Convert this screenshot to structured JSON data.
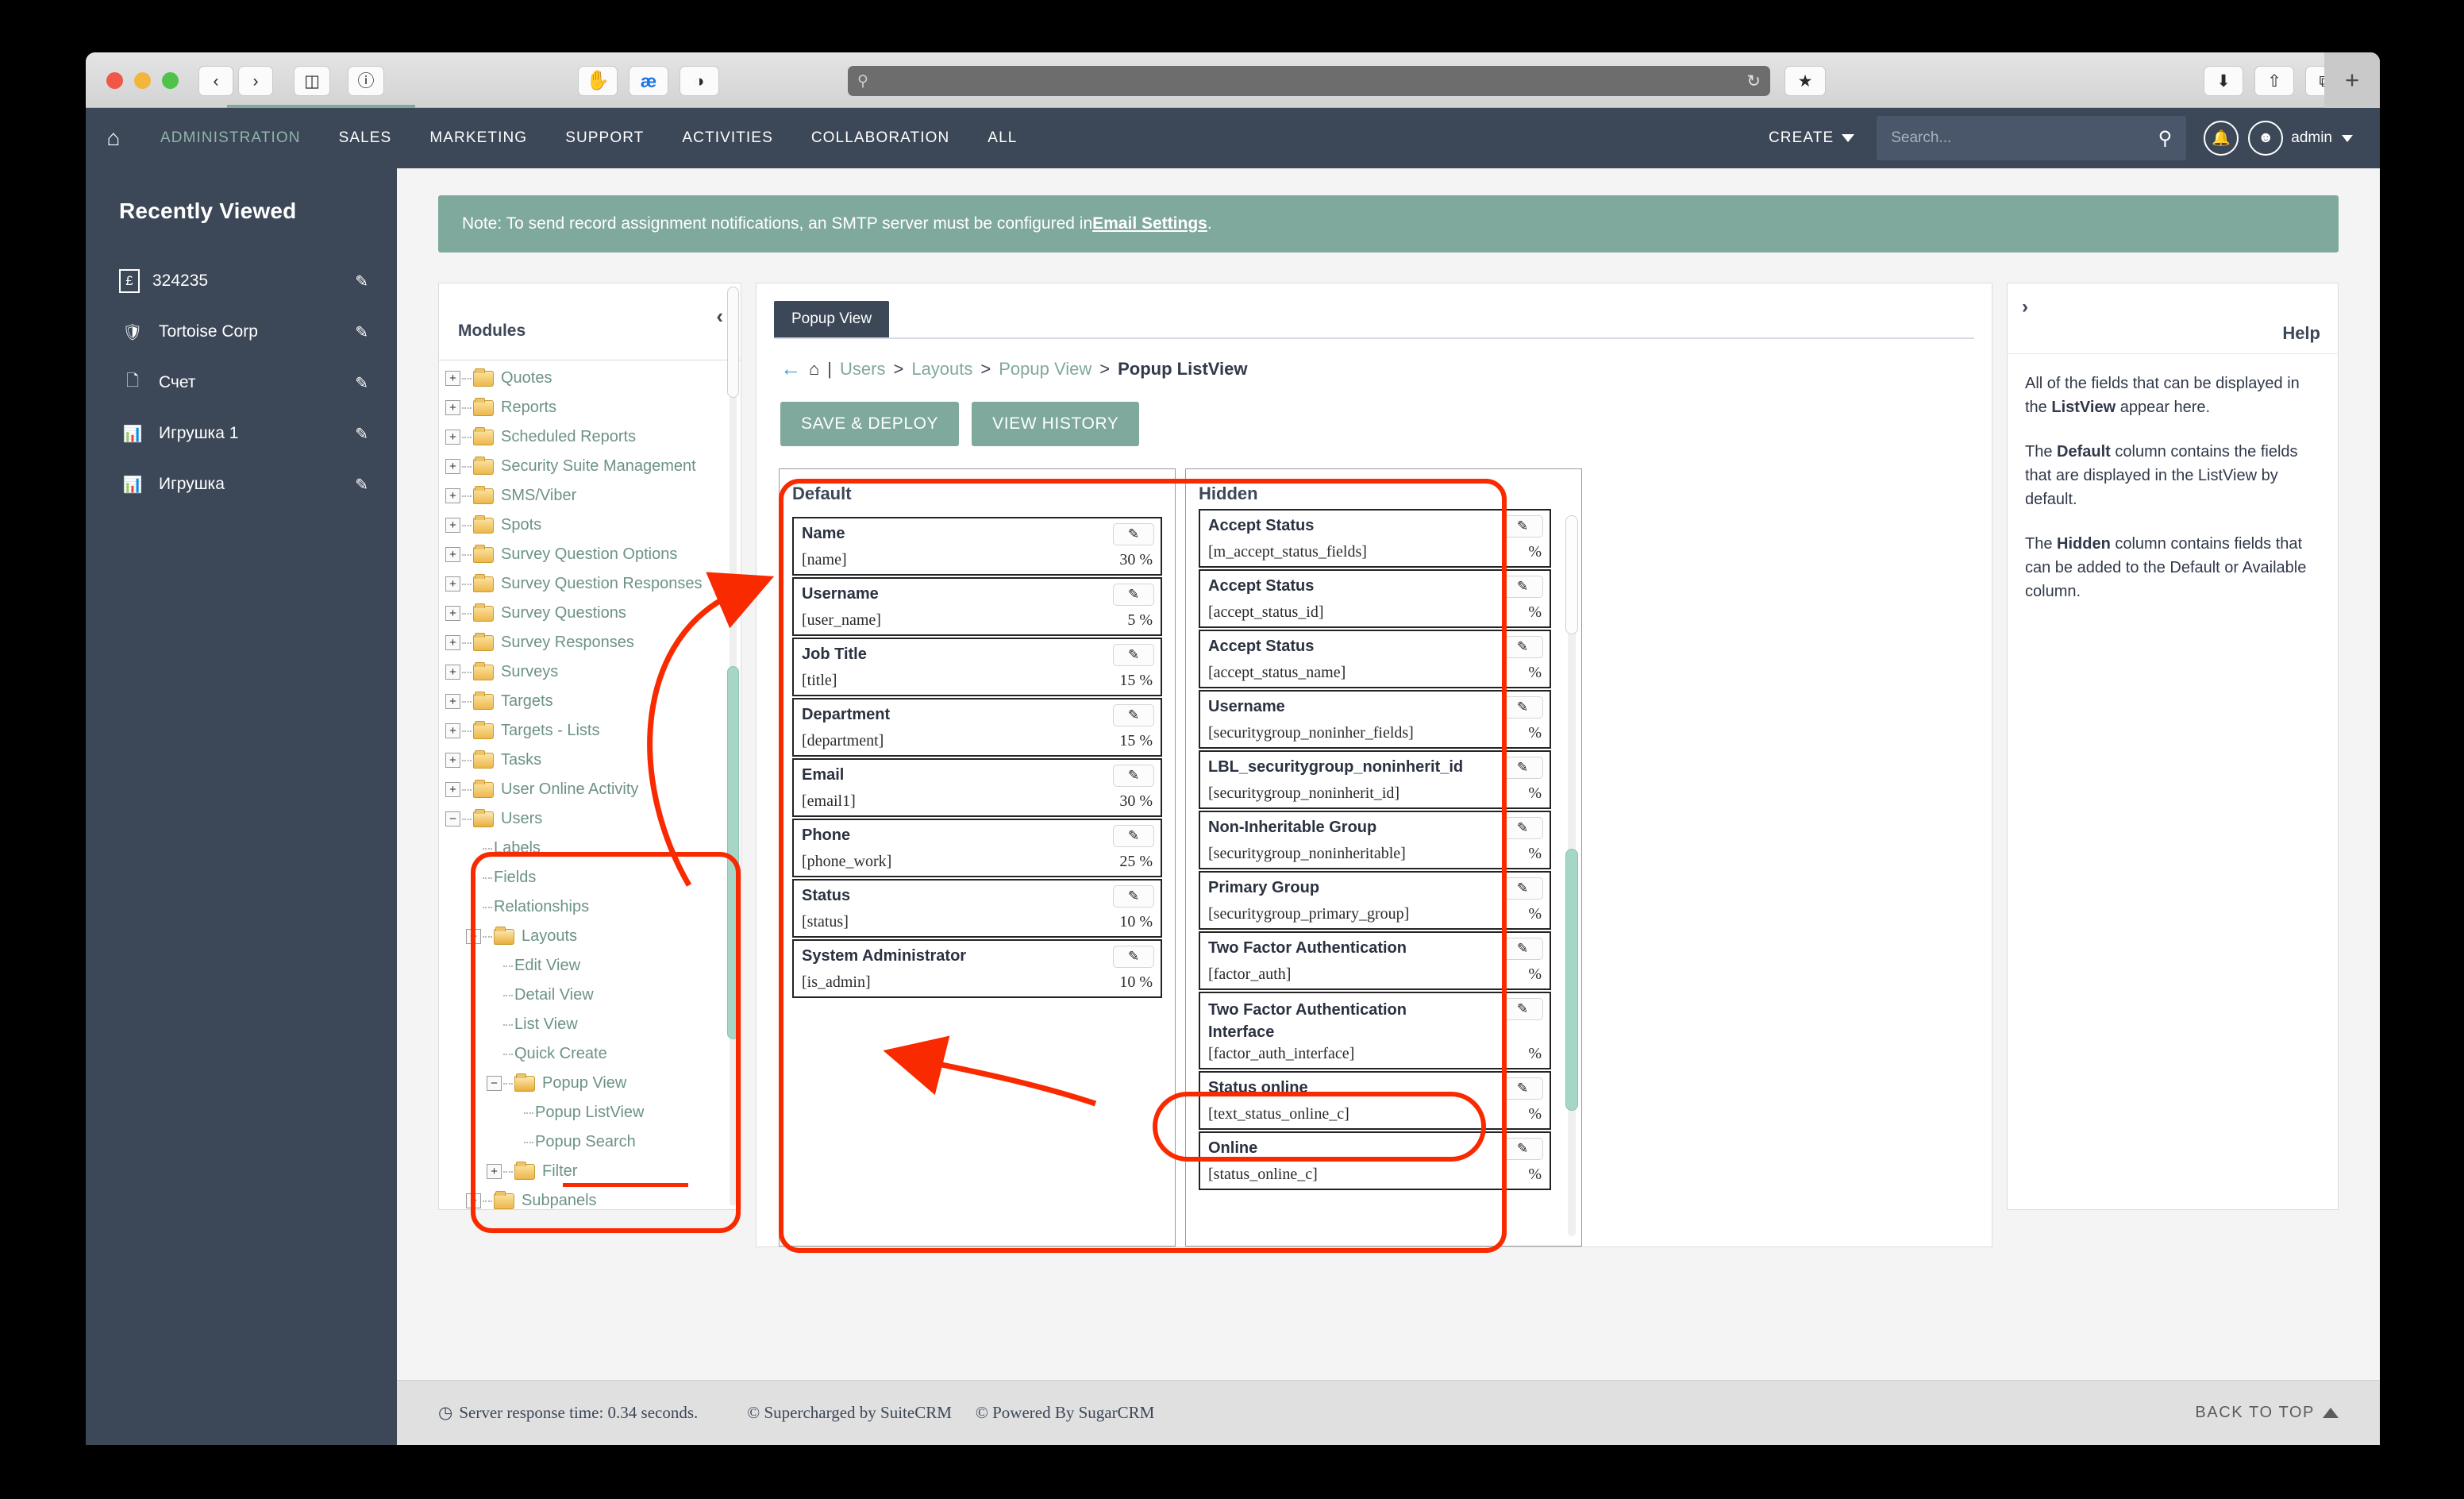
{
  "browser": {
    "buttons": [
      "back-icon",
      "forward-icon",
      "sidebar-icon",
      "info-icon",
      "adblock-icon",
      "ae-icon",
      "shield-icon"
    ],
    "url_placeholder": "",
    "search_glyph": "⌕",
    "reload_glyph": "↻",
    "reader_glyph": "★",
    "download_glyph": "⬇",
    "share_glyph": "↑",
    "tabs_glyph": "⧉",
    "newtab_glyph": "+"
  },
  "topnav": {
    "home_icon": "home-icon",
    "items": [
      {
        "label": "ADMINISTRATION",
        "active": true
      },
      {
        "label": "SALES",
        "active": false
      },
      {
        "label": "MARKETING",
        "active": false
      },
      {
        "label": "SUPPORT",
        "active": false
      },
      {
        "label": "ACTIVITIES",
        "active": false
      },
      {
        "label": "COLLABORATION",
        "active": false
      },
      {
        "label": "ALL",
        "active": false
      }
    ],
    "create_label": "CREATE",
    "search_placeholder": "Search...",
    "user_label": "admin",
    "accent_color": "#8FB5AA",
    "bar_color": "#3C4757"
  },
  "sidebar": {
    "title": "Recently Viewed",
    "collapse_glyph": "◁",
    "items": [
      {
        "icon": "invoice-icon",
        "glyph": "£",
        "label": "324235"
      },
      {
        "icon": "shield-icon",
        "glyph": "⬟",
        "label": "Tortoise Corp"
      },
      {
        "icon": "document-icon",
        "glyph": "⬜",
        "label": "Счет"
      },
      {
        "icon": "chart-icon",
        "glyph": "█",
        "label": "Игрушка 1"
      },
      {
        "icon": "chart-icon",
        "glyph": "█",
        "label": "Игрушка"
      }
    ],
    "edit_glyph": "✎"
  },
  "note": {
    "text_before": "Note: To send record assignment notifications, an SMTP server must be configured in ",
    "link": "Email Settings",
    "text_after": ".",
    "color": "#7FA99D"
  },
  "tree": {
    "panel_label": "Modules",
    "collapse_glyph": "‹",
    "nodes": [
      {
        "label": "Quotes",
        "depth": 0,
        "toggle": "+",
        "folder": true
      },
      {
        "label": "Reports",
        "depth": 0,
        "toggle": "+",
        "folder": true
      },
      {
        "label": "Scheduled Reports",
        "depth": 0,
        "toggle": "+",
        "folder": true
      },
      {
        "label": "Security Suite Management",
        "depth": 0,
        "toggle": "+",
        "folder": true
      },
      {
        "label": "SMS/Viber",
        "depth": 0,
        "toggle": "+",
        "folder": true
      },
      {
        "label": "Spots",
        "depth": 0,
        "toggle": "+",
        "folder": true
      },
      {
        "label": "Survey Question Options",
        "depth": 0,
        "toggle": "+",
        "folder": true
      },
      {
        "label": "Survey Question Responses",
        "depth": 0,
        "toggle": "+",
        "folder": true
      },
      {
        "label": "Survey Questions",
        "depth": 0,
        "toggle": "+",
        "folder": true
      },
      {
        "label": "Survey Responses",
        "depth": 0,
        "toggle": "+",
        "folder": true
      },
      {
        "label": "Surveys",
        "depth": 0,
        "toggle": "+",
        "folder": true
      },
      {
        "label": "Targets",
        "depth": 0,
        "toggle": "+",
        "folder": true
      },
      {
        "label": "Targets - Lists",
        "depth": 0,
        "toggle": "+",
        "folder": true
      },
      {
        "label": "Tasks",
        "depth": 0,
        "toggle": "+",
        "folder": true
      },
      {
        "label": "User Online Activity",
        "depth": 0,
        "toggle": "+",
        "folder": true
      },
      {
        "label": "Users",
        "depth": 0,
        "toggle": "−",
        "folder": true,
        "open": true
      },
      {
        "label": "Labels",
        "depth": 1,
        "toggle": "",
        "folder": false
      },
      {
        "label": "Fields",
        "depth": 1,
        "toggle": "",
        "folder": false
      },
      {
        "label": "Relationships",
        "depth": 1,
        "toggle": "",
        "folder": false
      },
      {
        "label": "Layouts",
        "depth": 1,
        "toggle": "−",
        "folder": true,
        "open": true
      },
      {
        "label": "Edit View",
        "depth": 2,
        "toggle": "",
        "folder": false
      },
      {
        "label": "Detail View",
        "depth": 2,
        "toggle": "",
        "folder": false
      },
      {
        "label": "List View",
        "depth": 2,
        "toggle": "",
        "folder": false
      },
      {
        "label": "Quick Create",
        "depth": 2,
        "toggle": "",
        "folder": false
      },
      {
        "label": "Popup View",
        "depth": 2,
        "toggle": "−",
        "folder": true,
        "open": true
      },
      {
        "label": "Popup ListView",
        "depth": 3,
        "toggle": "",
        "folder": false,
        "selected": true
      },
      {
        "label": "Popup Search",
        "depth": 3,
        "toggle": "",
        "folder": false
      },
      {
        "label": "Filter",
        "depth": 2,
        "toggle": "+",
        "folder": true
      },
      {
        "label": "Subpanels",
        "depth": 1,
        "toggle": "+",
        "folder": true
      }
    ]
  },
  "editor": {
    "tab_label": "Popup View",
    "breadcrumb": {
      "back_glyph": "←",
      "home_glyph": "⌂",
      "divider": "|",
      "items": [
        "Users",
        "Layouts",
        "Popup View"
      ],
      "separator": ">",
      "current": "Popup ListView"
    },
    "buttons": [
      {
        "label": "SAVE & DEPLOY",
        "name": "save-and-deploy-button"
      },
      {
        "label": "VIEW HISTORY",
        "name": "view-history-button"
      }
    ],
    "edit_glyph": "✎",
    "columns": [
      {
        "title": "Default",
        "name": "default-column",
        "fields": [
          {
            "label": "Name",
            "key": "[name]",
            "pct": "30 %"
          },
          {
            "label": "Username",
            "key": "[user_name]",
            "pct": "5 %"
          },
          {
            "label": "Job Title",
            "key": "[title]",
            "pct": "15 %"
          },
          {
            "label": "Department",
            "key": "[department]",
            "pct": "15 %"
          },
          {
            "label": "Email",
            "key": "[email1]",
            "pct": "30 %"
          },
          {
            "label": "Phone",
            "key": "[phone_work]",
            "pct": "25 %"
          },
          {
            "label": "Status",
            "key": "[status]",
            "pct": "10 %"
          },
          {
            "label": "System Administrator",
            "key": "[is_admin]",
            "pct": "10 %"
          }
        ]
      },
      {
        "title": "Hidden",
        "name": "hidden-column",
        "fields": [
          {
            "label": "Accept Status",
            "key": "[m_accept_status_fields]",
            "pct": "%"
          },
          {
            "label": "Accept Status",
            "key": "[accept_status_id]",
            "pct": "%"
          },
          {
            "label": "Accept Status",
            "key": "[accept_status_name]",
            "pct": "%"
          },
          {
            "label": "Username",
            "key": "[securitygroup_noninher_fields]",
            "pct": "%"
          },
          {
            "label": "LBL_securitygroup_noninherit_id",
            "key": "[securitygroup_noninherit_id]",
            "pct": "%"
          },
          {
            "label": "Non-Inheritable Group",
            "key": "[securitygroup_noninheritable]",
            "pct": "%"
          },
          {
            "label": "Primary Group",
            "key": "[securitygroup_primary_group]",
            "pct": "%"
          },
          {
            "label": "Two Factor Authentication",
            "key": "[factor_auth]",
            "pct": "%"
          },
          {
            "label": "Two Factor Authentication Interface",
            "key": "[factor_auth_interface]",
            "pct": "%",
            "tall": true
          },
          {
            "label": "Status online",
            "key": "[text_status_online_c]",
            "pct": "%",
            "highlighted": true
          },
          {
            "label": "Online",
            "key": "[status_online_c]",
            "pct": "%"
          }
        ]
      }
    ]
  },
  "help": {
    "collapse_glyph": "›",
    "title": "Help",
    "paragraphs": [
      {
        "pre": "All of the fields that can be displayed in the ",
        "bold": "ListView",
        "post": " appear here."
      },
      {
        "pre": "The ",
        "bold": "Default",
        "post": " column contains the fields that are displayed in the ListView by default."
      },
      {
        "pre": "The ",
        "bold": "Hidden",
        "post": " column contains fields that can be added to the Default or Available column."
      }
    ]
  },
  "footer": {
    "clock_glyph": "◷",
    "response": "Server response time: 0.34 seconds.",
    "supercharged": "© Supercharged by SuiteCRM",
    "powered": "© Powered By SugarCRM",
    "back_to_top": "BACK TO TOP"
  },
  "annotations": {
    "color": "#F92A00",
    "note": "red highlight boxes and arrows drawn over the screenshot"
  }
}
